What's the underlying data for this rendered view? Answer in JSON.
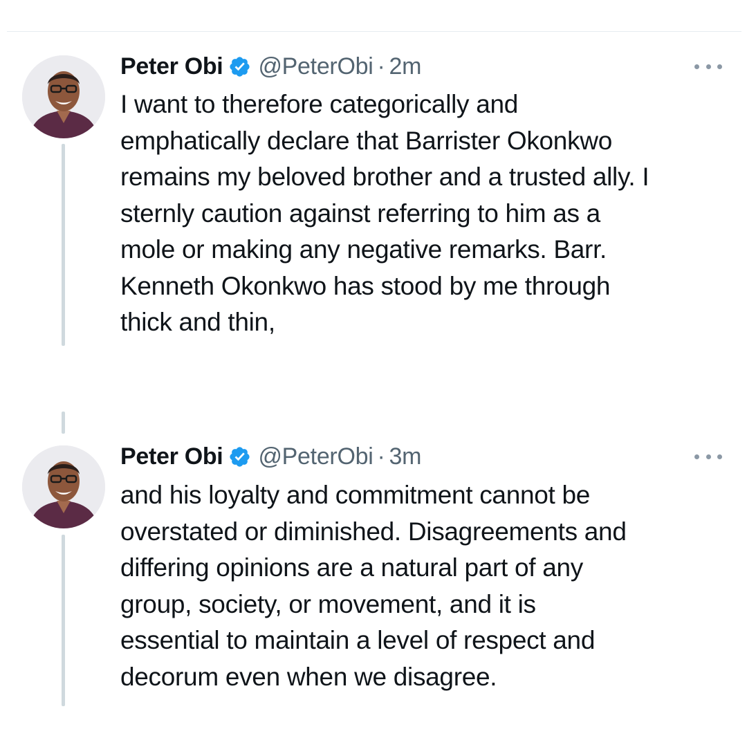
{
  "tweets": [
    {
      "author_name": "Peter Obi",
      "verified_icon": "verified-badge-icon",
      "handle": "@PeterObi",
      "separator": "·",
      "time": "2m",
      "more_icon": "more-options-icon",
      "text": "I want to therefore categorically and\nemphatically declare that Barrister Okonkwo\nremains my beloved brother and a trusted ally. I\nsternly caution against referring to him as a\nmole or making any negative remarks. Barr.\nKenneth Okonkwo has stood by me through\nthick and thin,"
    },
    {
      "author_name": "Peter Obi",
      "verified_icon": "verified-badge-icon",
      "handle": "@PeterObi",
      "separator": "·",
      "time": "3m",
      "more_icon": "more-options-icon",
      "text": "and his loyalty and commitment cannot be\noverstated or diminished. Disagreements and\ndiffering opinions are a natural part of any\ngroup, society, or movement, and it is\nessential to maintain a level of respect and\ndecorum even when we disagree."
    }
  ],
  "colors": {
    "verified_blue": "#1d9bf0",
    "text_primary": "#0f1419",
    "text_secondary": "#536471",
    "thread_line": "#cfd9de"
  }
}
